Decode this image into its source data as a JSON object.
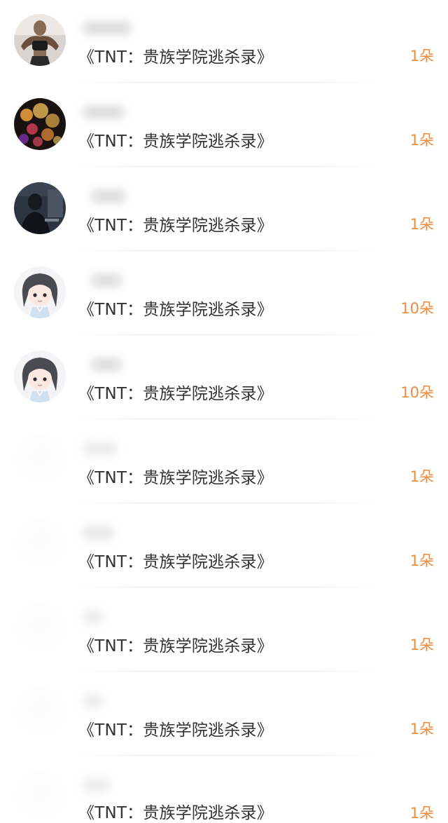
{
  "gift_list": {
    "items": [
      {
        "title": "《TNT：贵族学院逃杀录》",
        "amount": "1朵",
        "avatar": "athlete-photo-avatar"
      },
      {
        "title": "《TNT：贵族学院逃杀录》",
        "amount": "1朵",
        "avatar": "bokeh-lights-avatar"
      },
      {
        "title": "《TNT：贵族学院逃杀录》",
        "amount": "1朵",
        "avatar": "dark-silhouette-avatar"
      },
      {
        "title": "《TNT：贵族学院逃杀录》",
        "amount": "10朵",
        "avatar": "anime-character-avatar"
      },
      {
        "title": "《TNT：贵族学院逃杀录》",
        "amount": "10朵",
        "avatar": "anime-character-avatar"
      },
      {
        "title": "《TNT：贵族学院逃杀录》",
        "amount": "1朵",
        "avatar": "blank-avatar"
      },
      {
        "title": "《TNT：贵族学院逃杀录》",
        "amount": "1朵",
        "avatar": "blank-avatar"
      },
      {
        "title": "《TNT：贵族学院逃杀录》",
        "amount": "1朵",
        "avatar": "blank-avatar"
      },
      {
        "title": "《TNT：贵族学院逃杀录》",
        "amount": "1朵",
        "avatar": "blank-avatar"
      },
      {
        "title": "《TNT：贵族学院逃杀录》",
        "amount": "1朵",
        "avatar": "blank-avatar"
      }
    ]
  },
  "colors": {
    "amount": "#f08a3c",
    "title": "#333333",
    "divider": "#ececec"
  }
}
